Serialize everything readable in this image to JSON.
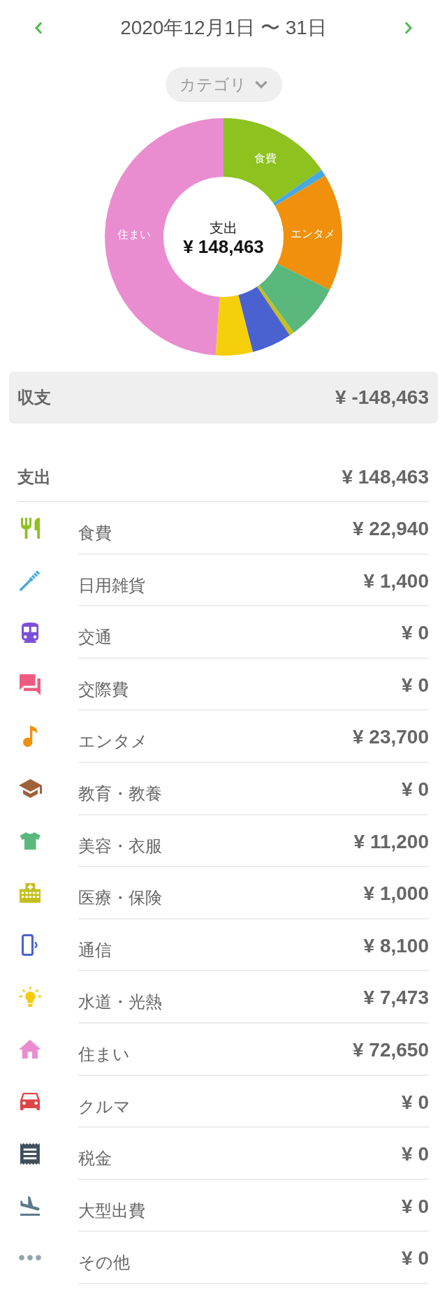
{
  "header": {
    "period": "2020年12月1日 〜 31日"
  },
  "filter": {
    "label": "カテゴリ"
  },
  "donut": {
    "center_label": "支出",
    "center_value": "¥ 148,463",
    "chart_data": {
      "type": "donut",
      "categories": [
        "食費",
        null,
        "エンタメ",
        null,
        null,
        null,
        null,
        "住まい"
      ],
      "values": [
        15.45,
        0.94,
        15.96,
        7.55,
        0.67,
        5.46,
        5.03,
        48.94
      ],
      "colors": [
        "#8dc21f",
        "#4aa8e0",
        "#f0900c",
        "#5ab87c",
        "#c4bf1e",
        "#4a62d0",
        "#f5d00a",
        "#ea8cd0"
      ]
    }
  },
  "balance": {
    "label": "収支",
    "value": "¥ -148,463"
  },
  "expenses": {
    "label": "支出",
    "total": "¥ 148,463",
    "items": [
      {
        "name": "食費",
        "amount": "¥ 22,940",
        "color": "#8dc21f"
      },
      {
        "name": "日用雑貨",
        "amount": "¥ 1,400",
        "color": "#4aa8e0"
      },
      {
        "name": "交通",
        "amount": "¥ 0",
        "color": "#7b4fd8"
      },
      {
        "name": "交際費",
        "amount": "¥ 0",
        "color": "#ef5b80"
      },
      {
        "name": "エンタメ",
        "amount": "¥ 23,700",
        "color": "#f0900c"
      },
      {
        "name": "教育・教養",
        "amount": "¥ 0",
        "color": "#a0603a"
      },
      {
        "name": "美容・衣服",
        "amount": "¥ 11,200",
        "color": "#5ab87c"
      },
      {
        "name": "医療・保険",
        "amount": "¥ 1,000",
        "color": "#c4bf1e"
      },
      {
        "name": "通信",
        "amount": "¥ 8,100",
        "color": "#4a62d0"
      },
      {
        "name": "水道・光熱",
        "amount": "¥ 7,473",
        "color": "#f5cc0a"
      },
      {
        "name": "住まい",
        "amount": "¥ 72,650",
        "color": "#ea8cd0"
      },
      {
        "name": "クルマ",
        "amount": "¥ 0",
        "color": "#e04545"
      },
      {
        "name": "税金",
        "amount": "¥ 0",
        "color": "#3f505c"
      },
      {
        "name": "大型出費",
        "amount": "¥ 0",
        "color": "#5b7a8c"
      },
      {
        "name": "その他",
        "amount": "¥ 0",
        "color": "#90a4ae"
      }
    ]
  }
}
